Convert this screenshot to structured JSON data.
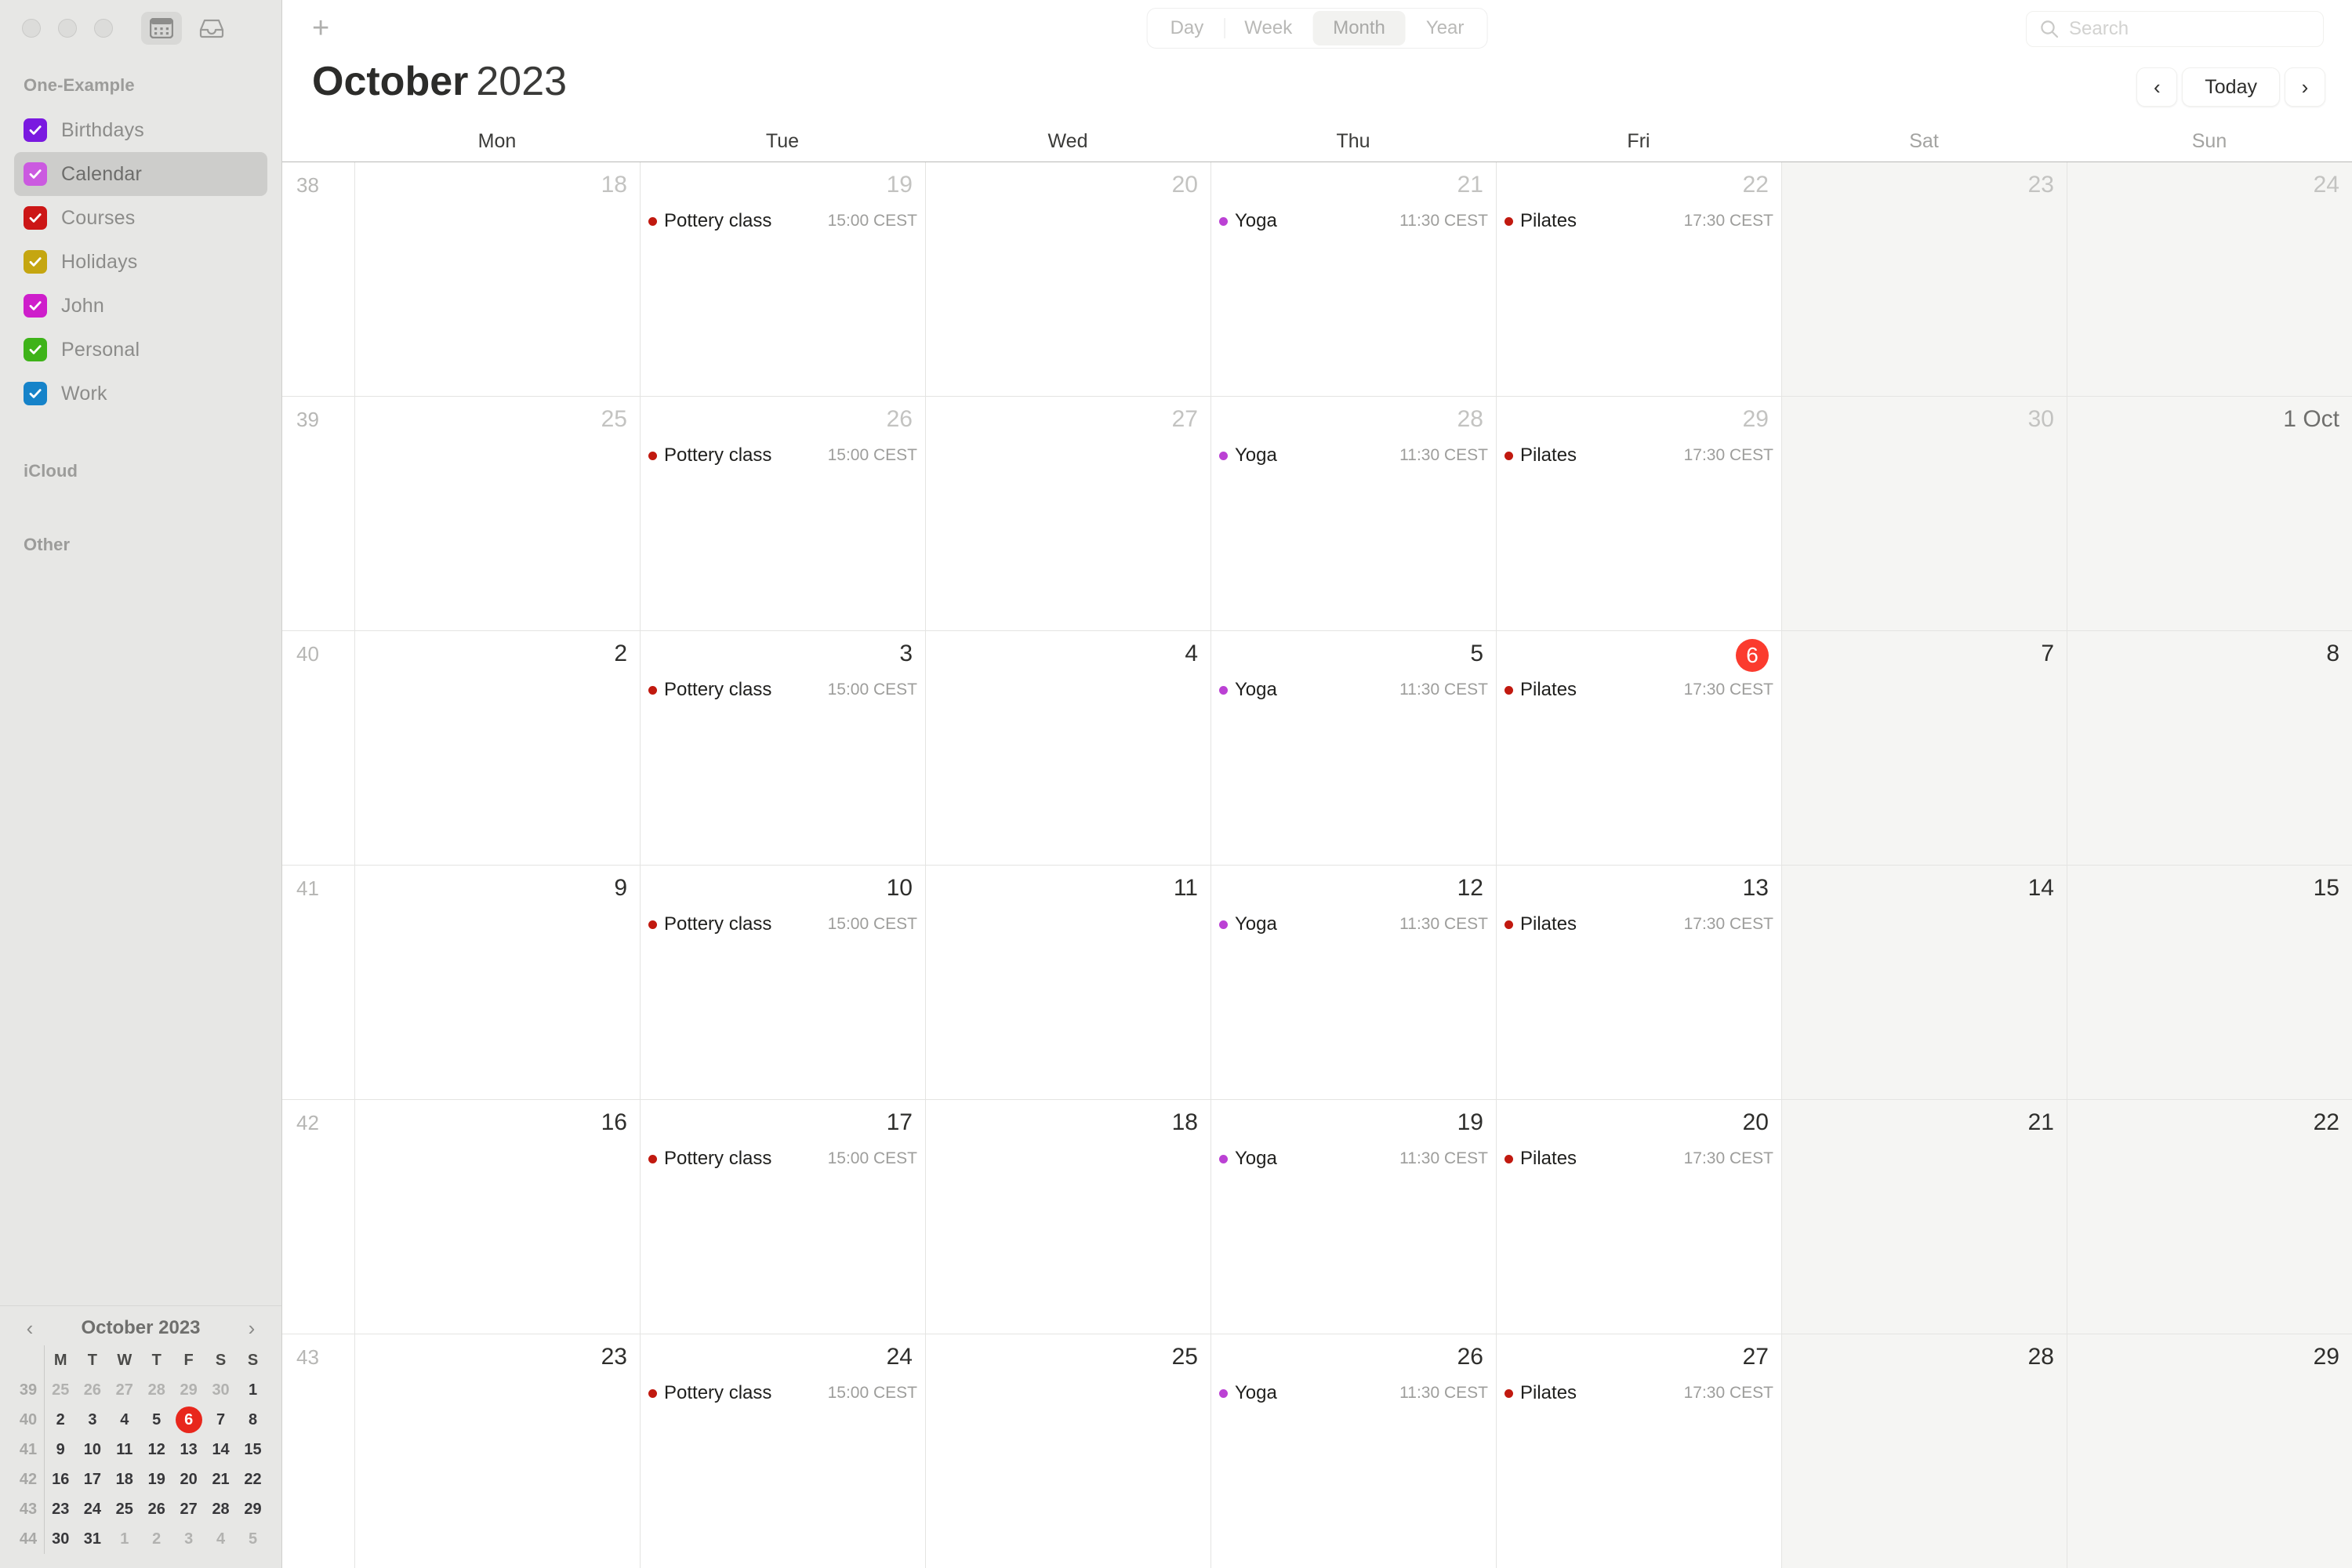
{
  "window": {
    "traffic_lights": [
      "close",
      "minimize",
      "zoom"
    ],
    "toolbar_icons": [
      {
        "name": "calendar-view-icon",
        "selected": true
      },
      {
        "name": "inbox-icon",
        "selected": false
      }
    ]
  },
  "sidebar": {
    "sections": [
      {
        "title": "One-Example",
        "items": [
          {
            "label": "Birthdays",
            "color": "#7a19e0",
            "checked": true,
            "active": false
          },
          {
            "label": "Calendar",
            "color": "#cb5ae0",
            "checked": true,
            "active": true
          },
          {
            "label": "Courses",
            "color": "#cc1616",
            "checked": true,
            "active": false
          },
          {
            "label": "Holidays",
            "color": "#c5a610",
            "checked": true,
            "active": false
          },
          {
            "label": "John",
            "color": "#ce1ecb",
            "checked": true,
            "active": false
          },
          {
            "label": "Personal",
            "color": "#3eb319",
            "checked": true,
            "active": false
          },
          {
            "label": "Work",
            "color": "#1683c9",
            "checked": true,
            "active": false
          }
        ]
      },
      {
        "title": "iCloud",
        "items": []
      },
      {
        "title": "Other",
        "items": []
      }
    ],
    "minicalendar": {
      "title": "October 2023",
      "prev_label": "‹",
      "next_label": "›",
      "weekday_headers": [
        "M",
        "T",
        "W",
        "T",
        "F",
        "S",
        "S"
      ],
      "rows": [
        {
          "week": "39",
          "days": [
            {
              "d": "25",
              "out": true
            },
            {
              "d": "26",
              "out": true
            },
            {
              "d": "27",
              "out": true
            },
            {
              "d": "28",
              "out": true
            },
            {
              "d": "29",
              "out": true
            },
            {
              "d": "30",
              "out": true
            },
            {
              "d": "1",
              "out": false
            }
          ]
        },
        {
          "week": "40",
          "days": [
            {
              "d": "2",
              "out": false
            },
            {
              "d": "3",
              "out": false
            },
            {
              "d": "4",
              "out": false
            },
            {
              "d": "5",
              "out": false
            },
            {
              "d": "6",
              "out": false,
              "today": true
            },
            {
              "d": "7",
              "out": false
            },
            {
              "d": "8",
              "out": false
            }
          ]
        },
        {
          "week": "41",
          "days": [
            {
              "d": "9",
              "out": false
            },
            {
              "d": "10",
              "out": false
            },
            {
              "d": "11",
              "out": false
            },
            {
              "d": "12",
              "out": false
            },
            {
              "d": "13",
              "out": false
            },
            {
              "d": "14",
              "out": false
            },
            {
              "d": "15",
              "out": false
            }
          ]
        },
        {
          "week": "42",
          "days": [
            {
              "d": "16",
              "out": false
            },
            {
              "d": "17",
              "out": false
            },
            {
              "d": "18",
              "out": false
            },
            {
              "d": "19",
              "out": false
            },
            {
              "d": "20",
              "out": false
            },
            {
              "d": "21",
              "out": false
            },
            {
              "d": "22",
              "out": false
            }
          ]
        },
        {
          "week": "43",
          "days": [
            {
              "d": "23",
              "out": false
            },
            {
              "d": "24",
              "out": false
            },
            {
              "d": "25",
              "out": false
            },
            {
              "d": "26",
              "out": false
            },
            {
              "d": "27",
              "out": false
            },
            {
              "d": "28",
              "out": false
            },
            {
              "d": "29",
              "out": false
            }
          ]
        },
        {
          "week": "44",
          "days": [
            {
              "d": "30",
              "out": false
            },
            {
              "d": "31",
              "out": false
            },
            {
              "d": "1",
              "out": true
            },
            {
              "d": "2",
              "out": true
            },
            {
              "d": "3",
              "out": true
            },
            {
              "d": "4",
              "out": true
            },
            {
              "d": "5",
              "out": true
            }
          ]
        }
      ]
    }
  },
  "toolbar": {
    "add_label": "+",
    "views": [
      {
        "label": "Day",
        "selected": false
      },
      {
        "label": "Week",
        "selected": false
      },
      {
        "label": "Month",
        "selected": true
      },
      {
        "label": "Year",
        "selected": false
      }
    ],
    "search_placeholder": "Search"
  },
  "header": {
    "month": "October",
    "year": "2023",
    "prev_label": "‹",
    "today_label": "Today",
    "next_label": "›"
  },
  "calendar": {
    "weekday_headers": [
      {
        "label": "Mon",
        "weekend": false
      },
      {
        "label": "Tue",
        "weekend": false
      },
      {
        "label": "Wed",
        "weekend": false
      },
      {
        "label": "Thu",
        "weekend": false
      },
      {
        "label": "Fri",
        "weekend": false
      },
      {
        "label": "Sat",
        "weekend": true
      },
      {
        "label": "Sun",
        "weekend": true
      }
    ],
    "event_colors": {
      "pottery": "#c1190f",
      "yoga": "#bb41d4",
      "pilates": "#c1190f"
    },
    "today_color": "#fb3b2e",
    "weeks": [
      {
        "week": "38",
        "days": [
          {
            "num": "18",
            "out": true,
            "weekend": false,
            "events": []
          },
          {
            "num": "19",
            "out": true,
            "weekend": false,
            "events": [
              {
                "title": "Pottery class",
                "time": "15:00 CEST",
                "color": "#c1190f"
              }
            ]
          },
          {
            "num": "20",
            "out": true,
            "weekend": false,
            "events": []
          },
          {
            "num": "21",
            "out": true,
            "weekend": false,
            "events": [
              {
                "title": "Yoga",
                "time": "11:30 CEST",
                "color": "#bb41d4"
              }
            ]
          },
          {
            "num": "22",
            "out": true,
            "weekend": false,
            "events": [
              {
                "title": "Pilates",
                "time": "17:30 CEST",
                "color": "#c1190f"
              }
            ]
          },
          {
            "num": "23",
            "out": true,
            "weekend": true,
            "events": []
          },
          {
            "num": "24",
            "out": true,
            "weekend": true,
            "events": []
          }
        ]
      },
      {
        "week": "39",
        "days": [
          {
            "num": "25",
            "out": true,
            "weekend": false,
            "events": []
          },
          {
            "num": "26",
            "out": true,
            "weekend": false,
            "events": [
              {
                "title": "Pottery class",
                "time": "15:00 CEST",
                "color": "#c1190f"
              }
            ]
          },
          {
            "num": "27",
            "out": true,
            "weekend": false,
            "events": []
          },
          {
            "num": "28",
            "out": true,
            "weekend": false,
            "events": [
              {
                "title": "Yoga",
                "time": "11:30 CEST",
                "color": "#bb41d4"
              }
            ]
          },
          {
            "num": "29",
            "out": true,
            "weekend": false,
            "events": [
              {
                "title": "Pilates",
                "time": "17:30 CEST",
                "color": "#c1190f"
              }
            ]
          },
          {
            "num": "30",
            "out": true,
            "weekend": true,
            "events": []
          },
          {
            "num": "1 Oct",
            "out": false,
            "other_month_label": true,
            "weekend": true,
            "events": []
          }
        ]
      },
      {
        "week": "40",
        "days": [
          {
            "num": "2",
            "out": false,
            "weekend": false,
            "events": []
          },
          {
            "num": "3",
            "out": false,
            "weekend": false,
            "events": [
              {
                "title": "Pottery class",
                "time": "15:00 CEST",
                "color": "#c1190f"
              }
            ]
          },
          {
            "num": "4",
            "out": false,
            "weekend": false,
            "events": []
          },
          {
            "num": "5",
            "out": false,
            "weekend": false,
            "events": [
              {
                "title": "Yoga",
                "time": "11:30 CEST",
                "color": "#bb41d4"
              }
            ]
          },
          {
            "num": "6",
            "out": false,
            "today": true,
            "weekend": false,
            "events": [
              {
                "title": "Pilates",
                "time": "17:30 CEST",
                "color": "#c1190f"
              }
            ]
          },
          {
            "num": "7",
            "out": false,
            "weekend": true,
            "events": []
          },
          {
            "num": "8",
            "out": false,
            "weekend": true,
            "events": []
          }
        ]
      },
      {
        "week": "41",
        "days": [
          {
            "num": "9",
            "out": false,
            "weekend": false,
            "events": []
          },
          {
            "num": "10",
            "out": false,
            "weekend": false,
            "events": [
              {
                "title": "Pottery class",
                "time": "15:00 CEST",
                "color": "#c1190f"
              }
            ]
          },
          {
            "num": "11",
            "out": false,
            "weekend": false,
            "events": []
          },
          {
            "num": "12",
            "out": false,
            "weekend": false,
            "events": [
              {
                "title": "Yoga",
                "time": "11:30 CEST",
                "color": "#bb41d4"
              }
            ]
          },
          {
            "num": "13",
            "out": false,
            "weekend": false,
            "events": [
              {
                "title": "Pilates",
                "time": "17:30 CEST",
                "color": "#c1190f"
              }
            ]
          },
          {
            "num": "14",
            "out": false,
            "weekend": true,
            "events": []
          },
          {
            "num": "15",
            "out": false,
            "weekend": true,
            "events": []
          }
        ]
      },
      {
        "week": "42",
        "days": [
          {
            "num": "16",
            "out": false,
            "weekend": false,
            "events": []
          },
          {
            "num": "17",
            "out": false,
            "weekend": false,
            "events": [
              {
                "title": "Pottery class",
                "time": "15:00 CEST",
                "color": "#c1190f"
              }
            ]
          },
          {
            "num": "18",
            "out": false,
            "weekend": false,
            "events": []
          },
          {
            "num": "19",
            "out": false,
            "weekend": false,
            "events": [
              {
                "title": "Yoga",
                "time": "11:30 CEST",
                "color": "#bb41d4"
              }
            ]
          },
          {
            "num": "20",
            "out": false,
            "weekend": false,
            "events": [
              {
                "title": "Pilates",
                "time": "17:30 CEST",
                "color": "#c1190f"
              }
            ]
          },
          {
            "num": "21",
            "out": false,
            "weekend": true,
            "events": []
          },
          {
            "num": "22",
            "out": false,
            "weekend": true,
            "events": []
          }
        ]
      },
      {
        "week": "43",
        "days": [
          {
            "num": "23",
            "out": false,
            "weekend": false,
            "events": []
          },
          {
            "num": "24",
            "out": false,
            "weekend": false,
            "events": [
              {
                "title": "Pottery class",
                "time": "15:00 CEST",
                "color": "#c1190f"
              }
            ]
          },
          {
            "num": "25",
            "out": false,
            "weekend": false,
            "events": []
          },
          {
            "num": "26",
            "out": false,
            "weekend": false,
            "events": [
              {
                "title": "Yoga",
                "time": "11:30 CEST",
                "color": "#bb41d4"
              }
            ]
          },
          {
            "num": "27",
            "out": false,
            "weekend": false,
            "events": [
              {
                "title": "Pilates",
                "time": "17:30 CEST",
                "color": "#c1190f"
              }
            ]
          },
          {
            "num": "28",
            "out": false,
            "weekend": true,
            "events": []
          },
          {
            "num": "29",
            "out": false,
            "weekend": true,
            "events": []
          }
        ]
      }
    ]
  }
}
